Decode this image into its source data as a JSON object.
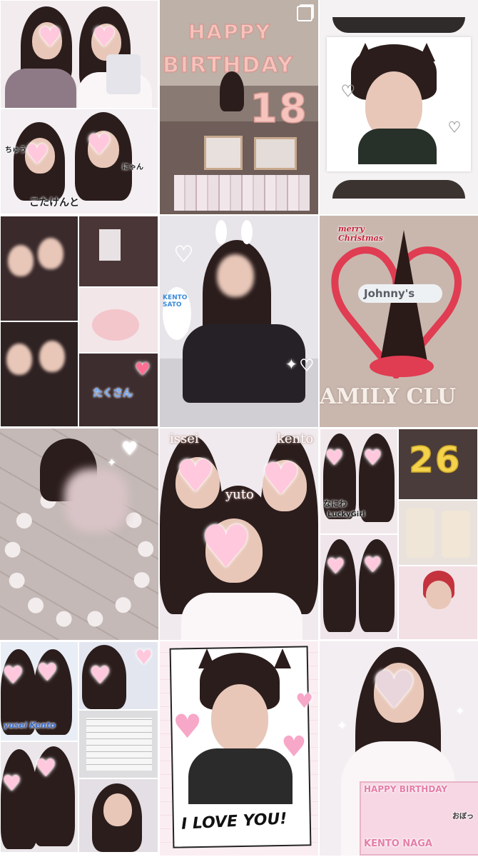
{
  "grid": {
    "columns": 3,
    "rows": 4,
    "tiles": [
      {
        "label": "purikura-pair-collage",
        "captions": {
          "bottom_left": "こたけんと",
          "side_a": "ちゅう",
          "side_b": "にゃん"
        }
      },
      {
        "label": "birthday-party-room",
        "captions": {
          "balloons_1": "HAPPY",
          "balloons_2": "BIRTHDAY",
          "number": "18"
        }
      },
      {
        "label": "cat-ear-photo-card",
        "captions": {}
      },
      {
        "label": "friends-cake-collage",
        "captions": {
          "bottom": "たくさん"
        }
      },
      {
        "label": "bunny-ear-sticker-photo",
        "captions": {
          "sign": "KENTO SATO"
        }
      },
      {
        "label": "christmas-tree-heart",
        "captions": {
          "top": "merry Christmas",
          "sign": "Johnny's",
          "bottom": "AMILY CLU"
        }
      },
      {
        "label": "uchiwa-fan-circle",
        "captions": {}
      },
      {
        "label": "three-friends-hearts",
        "captions": {
          "left": "issei",
          "right": "kento",
          "middle": "yuto"
        }
      },
      {
        "label": "lucky-girl-26-collage",
        "captions": {
          "number": "26",
          "text_1": "なにわ",
          "text_2": "LuckyGirl"
        }
      },
      {
        "label": "kento-yusei-collage",
        "captions": {
          "side": "yusei Kento"
        }
      },
      {
        "label": "i-love-you-card",
        "captions": {
          "bottom": "I LOVE YOU!"
        }
      },
      {
        "label": "birthday-banner-girl",
        "captions": {
          "banner_top": "HAPPY BIRTHDAY",
          "banner_bottom": "KENTO NAGA",
          "handwriting": "おぼっ"
        }
      }
    ]
  },
  "colors": {
    "pink_heart": "#ffc8dd",
    "hair": "#2b1d1c",
    "skin": "#e8c7b8",
    "balloon_rosegold": "#f0c4bc",
    "christmas_red": "#e03c52"
  },
  "icons": [
    "multiple-photos-icon"
  ]
}
